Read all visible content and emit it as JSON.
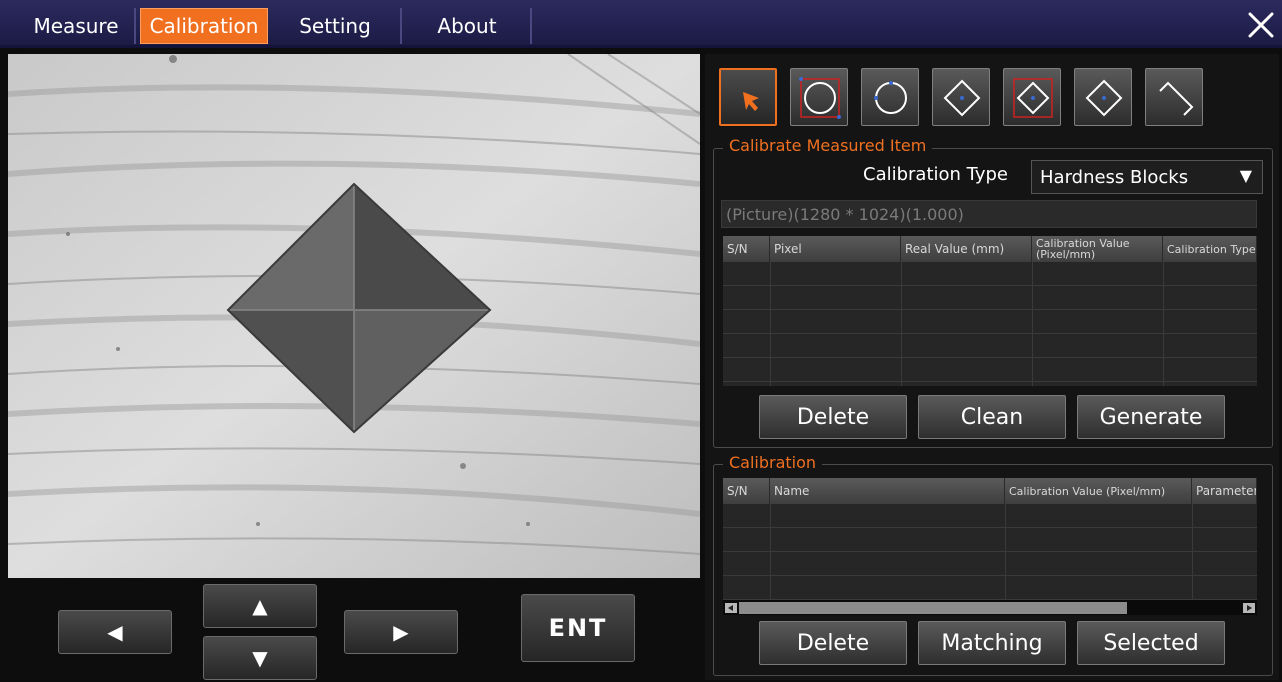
{
  "menu": {
    "tabs": [
      {
        "label": "Measure"
      },
      {
        "label": "Calibration",
        "active": true
      },
      {
        "label": "Setting"
      },
      {
        "label": "About"
      }
    ],
    "close_icon": "close-icon"
  },
  "nav": {
    "left_icon": "arrow-left-icon",
    "up_icon": "arrow-up-icon",
    "down_icon": "arrow-down-icon",
    "right_icon": "arrow-right-icon",
    "ent_label": "ENT"
  },
  "tools": [
    {
      "icon": "pointer-arrow-icon",
      "active": true
    },
    {
      "icon": "circle-in-box-icon"
    },
    {
      "icon": "circle-icon"
    },
    {
      "icon": "diamond-icon"
    },
    {
      "icon": "diamond-in-box-icon"
    },
    {
      "icon": "diamond-center-icon"
    },
    {
      "icon": "diagonal-line-icon"
    }
  ],
  "calibrate_item": {
    "title": "Calibrate Measured Item",
    "type_label": "Calibration Type",
    "type_value": "Hardness Blocks",
    "info": "(Picture)(1280 * 1024)(1.000)",
    "columns": [
      "S/N",
      "Pixel",
      "Real Value (mm)",
      "Calibration Value (Pixel/mm)",
      "Calibration Type"
    ],
    "buttons": {
      "delete": "Delete",
      "clean": "Clean",
      "generate": "Generate"
    }
  },
  "calibration": {
    "title": "Calibration",
    "columns": [
      "S/N",
      "Name",
      "Calibration Value (Pixel/mm)",
      "Parameter"
    ],
    "buttons": {
      "delete": "Delete",
      "matching": "Matching",
      "selected": "Selected"
    }
  },
  "colors": {
    "accent": "#f07020",
    "menu_bg": "#1c1b45",
    "panel_bg": "#141414"
  }
}
